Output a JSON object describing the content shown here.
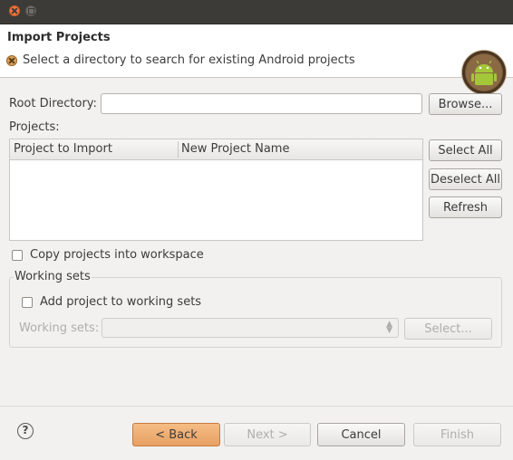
{
  "window": {
    "buttons": [
      "close",
      "maximize"
    ]
  },
  "banner": {
    "title": "Import Projects",
    "message": "Select a directory to search for existing Android projects",
    "message_icon": "error-icon",
    "logo": "android-logo"
  },
  "root_directory": {
    "label": "Root Directory:",
    "value": "",
    "browse_label": "Browse..."
  },
  "projects": {
    "label": "Projects:",
    "columns": [
      "Project to Import",
      "New Project Name"
    ],
    "rows": [],
    "select_all_label": "Select All",
    "deselect_all_label": "Deselect All",
    "refresh_label": "Refresh"
  },
  "copy_projects": {
    "label": "Copy projects into workspace",
    "checked": false
  },
  "working_sets": {
    "group_label": "Working sets",
    "add_label": "Add project to working sets",
    "add_checked": false,
    "field_label": "Working sets:",
    "field_value": "",
    "select_label": "Select..."
  },
  "footer": {
    "help_icon": "help-icon",
    "back_label": "< Back",
    "next_label": "Next >",
    "cancel_label": "Cancel",
    "finish_label": "Finish"
  },
  "colors": {
    "accent": "#e7a064",
    "titlebar": "#3c3b37",
    "background": "#f2f1f0"
  }
}
